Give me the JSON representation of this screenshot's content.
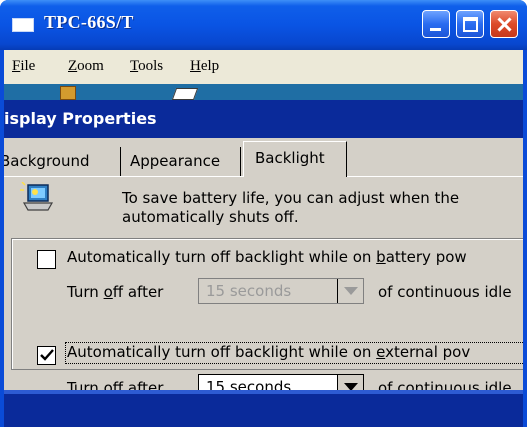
{
  "window": {
    "title": "TPC-66S/T"
  },
  "menu": {
    "items": [
      {
        "label": "File",
        "mnemonic": "F",
        "rest": "ile"
      },
      {
        "label": "Zoom",
        "mnemonic": "Z",
        "rest": "oom"
      },
      {
        "label": "Tools",
        "mnemonic": "T",
        "rest": "ools"
      },
      {
        "label": "Help",
        "mnemonic": "H",
        "rest": "elp"
      }
    ]
  },
  "dialog": {
    "title": "isplay Properties",
    "tabs": [
      {
        "label": "Background"
      },
      {
        "label": "Appearance"
      },
      {
        "label": "Backlight",
        "selected": true
      }
    ],
    "intro": {
      "line1": "To save battery life, you can adjust when the",
      "line2": "automatically shuts off."
    },
    "battery": {
      "checked": false,
      "label_pre": "Automatically turn off backlight while on ",
      "label_mnemonic": "b",
      "label_post": "attery pow",
      "turnoff_pre": "Turn ",
      "turnoff_mnemonic": "o",
      "turnoff_post": "ff after",
      "value": "15 seconds",
      "disabled": true,
      "idle_text": "of continuous idle"
    },
    "external": {
      "checked": true,
      "label_pre": "Automatically turn off backlight while on ",
      "label_mnemonic": "e",
      "label_post": "xternal pov",
      "turnoff_pre": "Turn off ",
      "turnoff_mnemonic": "a",
      "turnoff_post": "fter",
      "value": "15 seconds",
      "disabled": false,
      "idle_text": "of continuous idle"
    }
  },
  "colors": {
    "xp_titlebar": "#0a54e4",
    "dialog_titlebar": "#0a2a9a",
    "dialog_face": "#d4d0c8",
    "menu_face": "#ece9d8"
  }
}
